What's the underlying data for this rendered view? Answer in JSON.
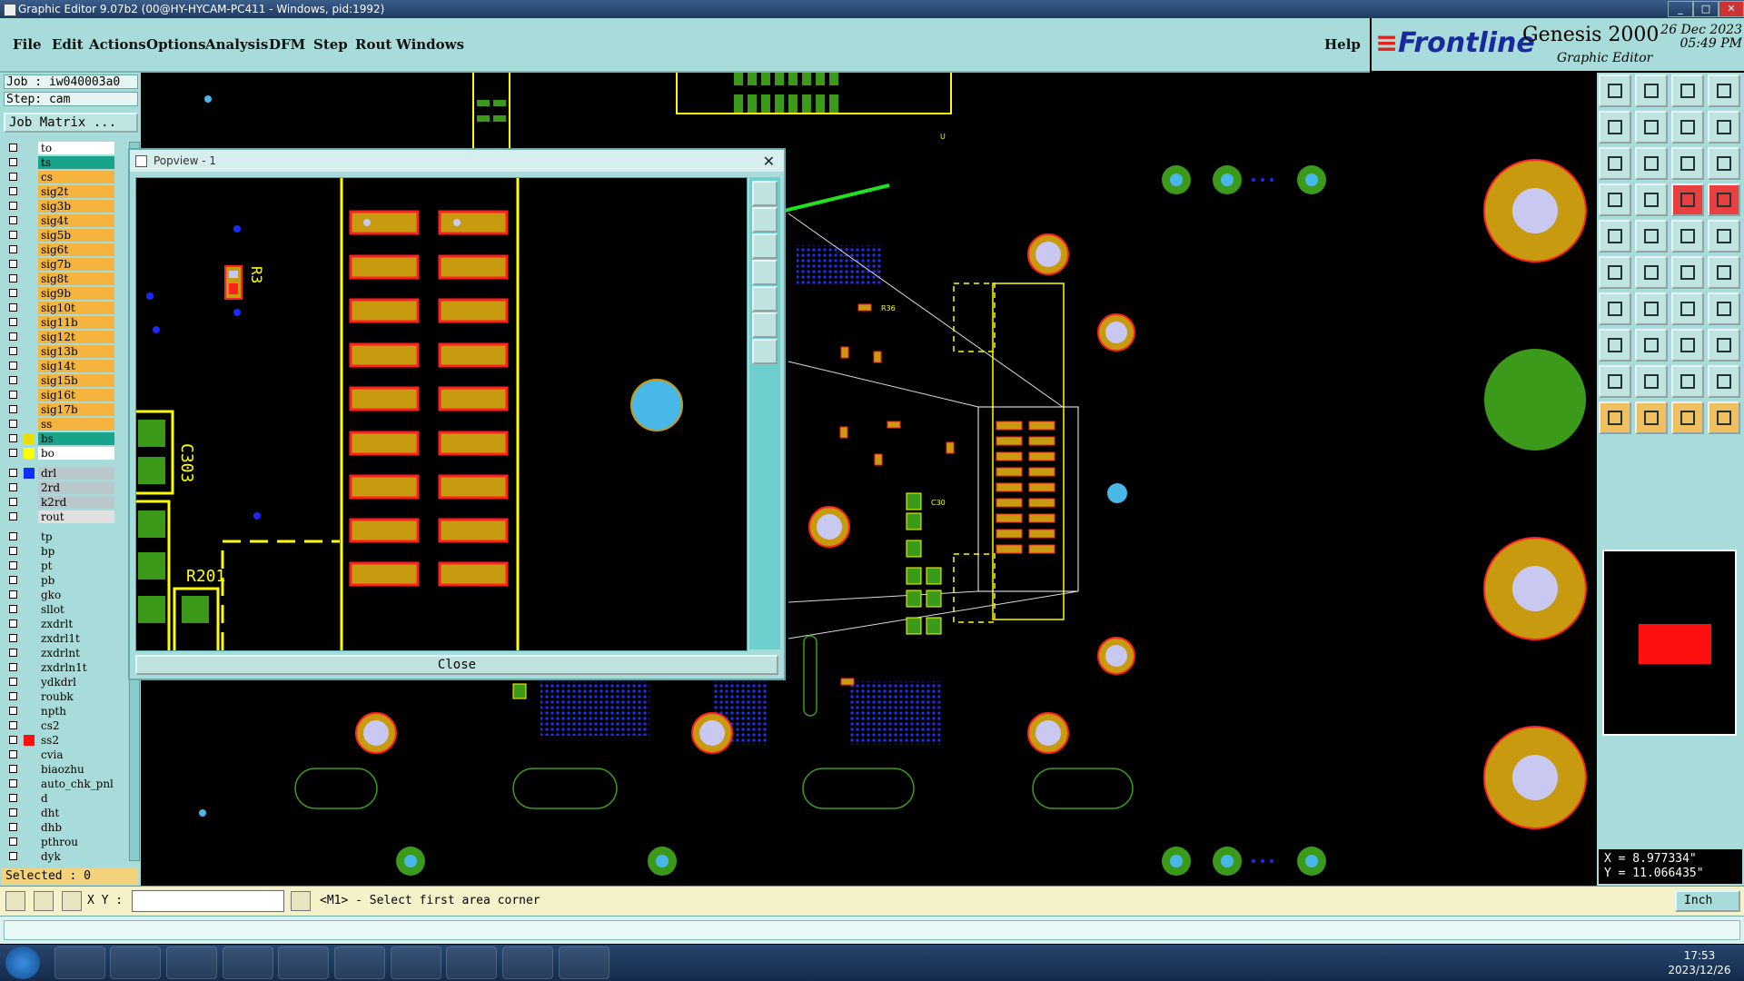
{
  "window": {
    "title": "Graphic Editor 9.07b2 (00@HY-HYCAM-PC411 - Windows, pid:1992)",
    "controls": [
      "_",
      "□",
      "✕"
    ]
  },
  "menu": {
    "items": [
      "File",
      "Edit",
      "Actions",
      "Options",
      "Analysis",
      "DFM",
      "Step",
      "Rout",
      "Windows"
    ],
    "help": "Help"
  },
  "brand": {
    "logo": "Frontline",
    "product": "Genesis 2000",
    "subtitle": "Graphic Editor",
    "date": "26 Dec 2023",
    "time": "05:49 PM"
  },
  "left_panel": {
    "job": "Job  :  iw040003a0",
    "step": "Step:  cam",
    "job_matrix": "Job Matrix ...",
    "layers": [
      {
        "name": "to",
        "color": "#ffffff"
      },
      {
        "name": "ts",
        "color": "#19a38a"
      },
      {
        "name": "cs",
        "color": "#f5b43e"
      },
      {
        "name": "sig2t",
        "color": "#f5b43e"
      },
      {
        "name": "sig3b",
        "color": "#f5b43e"
      },
      {
        "name": "sig4t",
        "color": "#f5b43e"
      },
      {
        "name": "sig5b",
        "color": "#f5b43e"
      },
      {
        "name": "sig6t",
        "color": "#f5b43e"
      },
      {
        "name": "sig7b",
        "color": "#f5b43e"
      },
      {
        "name": "sig8t",
        "color": "#f5b43e"
      },
      {
        "name": "sig9b",
        "color": "#f5b43e"
      },
      {
        "name": "sig10t",
        "color": "#f5b43e"
      },
      {
        "name": "sig11b",
        "color": "#f5b43e"
      },
      {
        "name": "sig12t",
        "color": "#f5b43e"
      },
      {
        "name": "sig13b",
        "color": "#f5b43e"
      },
      {
        "name": "sig14t",
        "color": "#f5b43e"
      },
      {
        "name": "sig15b",
        "color": "#f5b43e"
      },
      {
        "name": "sig16t",
        "color": "#f5b43e"
      },
      {
        "name": "sig17b",
        "color": "#f5b43e"
      },
      {
        "name": "ss",
        "color": "#f5b43e"
      },
      {
        "name": "bs",
        "color": "#19a38a",
        "swatch": "#e8e000"
      },
      {
        "name": "bo",
        "color": "#ffffff",
        "swatch": "#ffff00"
      },
      {
        "name": "drl",
        "color": "#b8c8cc",
        "swatch": "#1030ff"
      },
      {
        "name": "2rd",
        "color": "#b8c8cc"
      },
      {
        "name": "k2rd",
        "color": "#b8c8cc"
      },
      {
        "name": "rout",
        "color": "#e0e0e0"
      },
      {
        "name": "tp",
        "color": "#a8dcda"
      },
      {
        "name": "bp",
        "color": "#a8dcda"
      },
      {
        "name": "pt",
        "color": "#a8dcda"
      },
      {
        "name": "pb",
        "color": "#a8dcda"
      },
      {
        "name": "gko",
        "color": "#a8dcda"
      },
      {
        "name": "sllot",
        "color": "#a8dcda"
      },
      {
        "name": "zxdrlt",
        "color": "#a8dcda"
      },
      {
        "name": "zxdrl1t",
        "color": "#a8dcda"
      },
      {
        "name": "zxdrlnt",
        "color": "#a8dcda"
      },
      {
        "name": "zxdrln1t",
        "color": "#a8dcda"
      },
      {
        "name": "ydkdrl",
        "color": "#a8dcda"
      },
      {
        "name": "roubk",
        "color": "#a8dcda"
      },
      {
        "name": "npth",
        "color": "#a8dcda"
      },
      {
        "name": "cs2",
        "color": "#a8dcda"
      },
      {
        "name": "ss2",
        "color": "#a8dcda",
        "swatch": "#ff1010"
      },
      {
        "name": "cvia",
        "color": "#a8dcda"
      },
      {
        "name": "biaozhu",
        "color": "#a8dcda"
      },
      {
        "name": "auto_chk_pnl",
        "color": "#a8dcda"
      },
      {
        "name": "d",
        "color": "#a8dcda"
      },
      {
        "name": "dht",
        "color": "#a8dcda"
      },
      {
        "name": "dhb",
        "color": "#a8dcda"
      },
      {
        "name": "pthrou",
        "color": "#a8dcda"
      },
      {
        "name": "dyk",
        "color": "#a8dcda"
      }
    ],
    "selected": "Selected : 0"
  },
  "canvas_labels": {
    "designator_u": "U",
    "ref_r36": "R36",
    "ref_c30": "C30",
    "pop_label_c303": "C303",
    "pop_label_r201": "R201",
    "pop_label_r3": "R3"
  },
  "popview": {
    "title": "Popview - 1",
    "close_x": "✕",
    "close_button": "Close"
  },
  "right_tools": {
    "coords_x": "X = 8.977334\"",
    "coords_y": "Y = 11.066435\""
  },
  "status": {
    "xy_label": "X Y :",
    "xy_value": "",
    "prompt": "<M1> - Select first area corner",
    "unit": "Inch"
  },
  "taskbar": {
    "time": "17:53",
    "date": "2023/12/26"
  },
  "colors": {
    "panel": "#a8dcda",
    "pad_fill": "#c89a10",
    "pad_edge": "#ff2020",
    "silk": "#ffff00",
    "via_blue": "#1a2aff",
    "green_pad": "#3c9a1a"
  }
}
